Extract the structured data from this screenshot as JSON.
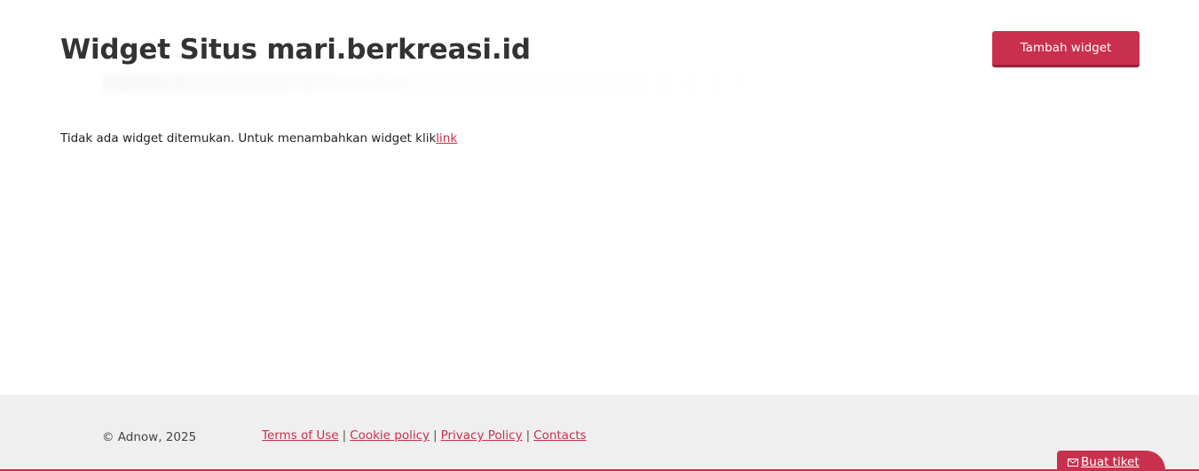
{
  "header": {
    "title": "Widget Situs mari.berkreasi.id",
    "add_button_label": "Tambah widget"
  },
  "main": {
    "empty_text": "Tidak ada widget ditemukan. Untuk menambahkan widget klik",
    "empty_link_label": "link"
  },
  "footer": {
    "copyright": "© Adnow, 2025",
    "links": [
      {
        "label": "Terms of Use"
      },
      {
        "label": "Cookie policy"
      },
      {
        "label": "Privacy Policy"
      },
      {
        "label": "Contacts"
      }
    ],
    "separator": "|"
  },
  "support": {
    "ticket_label": "Buat tiket",
    "icon": "mail-icon"
  },
  "colors": {
    "accent": "#c9304d",
    "footer_bg": "#efefef",
    "text": "#333333"
  }
}
